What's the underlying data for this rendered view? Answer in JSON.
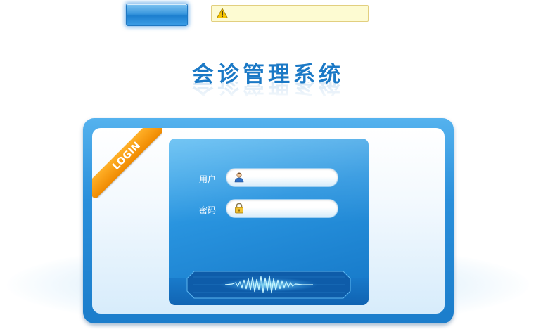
{
  "title": "会诊管理系统",
  "login_ribbon": "LOGIN",
  "form": {
    "username_label": "用户",
    "password_label": "密码",
    "username_value": "",
    "password_value": ""
  },
  "icons": {
    "warning": "warning-icon",
    "user": "user-icon",
    "lock": "lock-icon"
  },
  "colors": {
    "accent": "#1b79c6",
    "panel": "#2994df",
    "ribbon": "#f59a10",
    "warning_bg": "#fdfbd2"
  }
}
